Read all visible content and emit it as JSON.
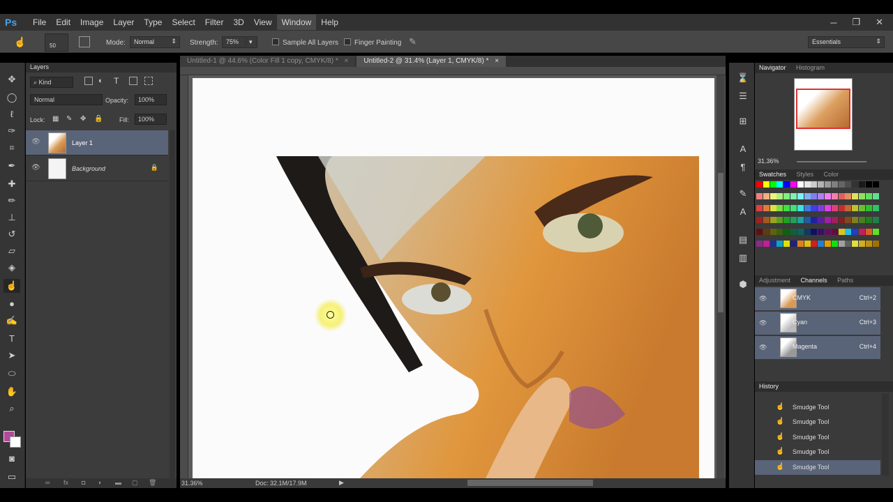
{
  "app": {
    "logo": "Ps",
    "minimize": "─",
    "maximize": "❐",
    "close": "✕"
  },
  "menu": [
    "File",
    "Edit",
    "Image",
    "Layer",
    "Type",
    "Select",
    "Filter",
    "3D",
    "View",
    "Window",
    "Help"
  ],
  "options": {
    "brush_size": "50",
    "mode_label": "Mode:",
    "mode_value": "Normal",
    "strength_label": "Strength:",
    "strength_value": "75%",
    "sample_all_layers": "Sample All Layers",
    "finger_painting": "Finger Painting",
    "workspace": "Essentials"
  },
  "tabs": [
    {
      "label": "Untitled-1 @ 44.6% (Color Fill 1 copy, CMYK/8) *",
      "active": false
    },
    {
      "label": "Untitled-2 @ 31.4% (Layer 1, CMYK/8) *",
      "active": true
    }
  ],
  "layers_panel": {
    "title": "Layers",
    "kind": "Kind",
    "blend": "Normal",
    "opacity_label": "Opacity:",
    "opacity_value": "100%",
    "lock_label": "Lock:",
    "fill_label": "Fill:",
    "fill_value": "100%",
    "layers": [
      {
        "name": "Layer 1",
        "selected": true
      },
      {
        "name": "Background",
        "selected": false,
        "locked": true
      }
    ]
  },
  "status": {
    "zoom": "31.36%",
    "doc": "Doc: 32.1M/17.9M"
  },
  "navigator": {
    "tabs": [
      "Navigator",
      "Histogram"
    ],
    "zoom": "31.36%"
  },
  "swatches": {
    "tabs": [
      "Swatches",
      "Styles",
      "Color"
    ]
  },
  "channels": {
    "tabs": [
      "Adjustment",
      "Channels",
      "Paths"
    ],
    "rows": [
      {
        "name": "CMYK",
        "shortcut": "Ctrl+2"
      },
      {
        "name": "Cyan",
        "shortcut": "Ctrl+3"
      },
      {
        "name": "Magenta",
        "shortcut": "Ctrl+4"
      }
    ]
  },
  "history": {
    "title": "History",
    "rows": [
      "Smudge Tool",
      "Smudge Tool",
      "Smudge Tool",
      "Smudge Tool",
      "Smudge Tool"
    ]
  },
  "colors": {
    "foreground": "#b04a9a",
    "background": "#ffffff",
    "accent": "#5a6478"
  }
}
